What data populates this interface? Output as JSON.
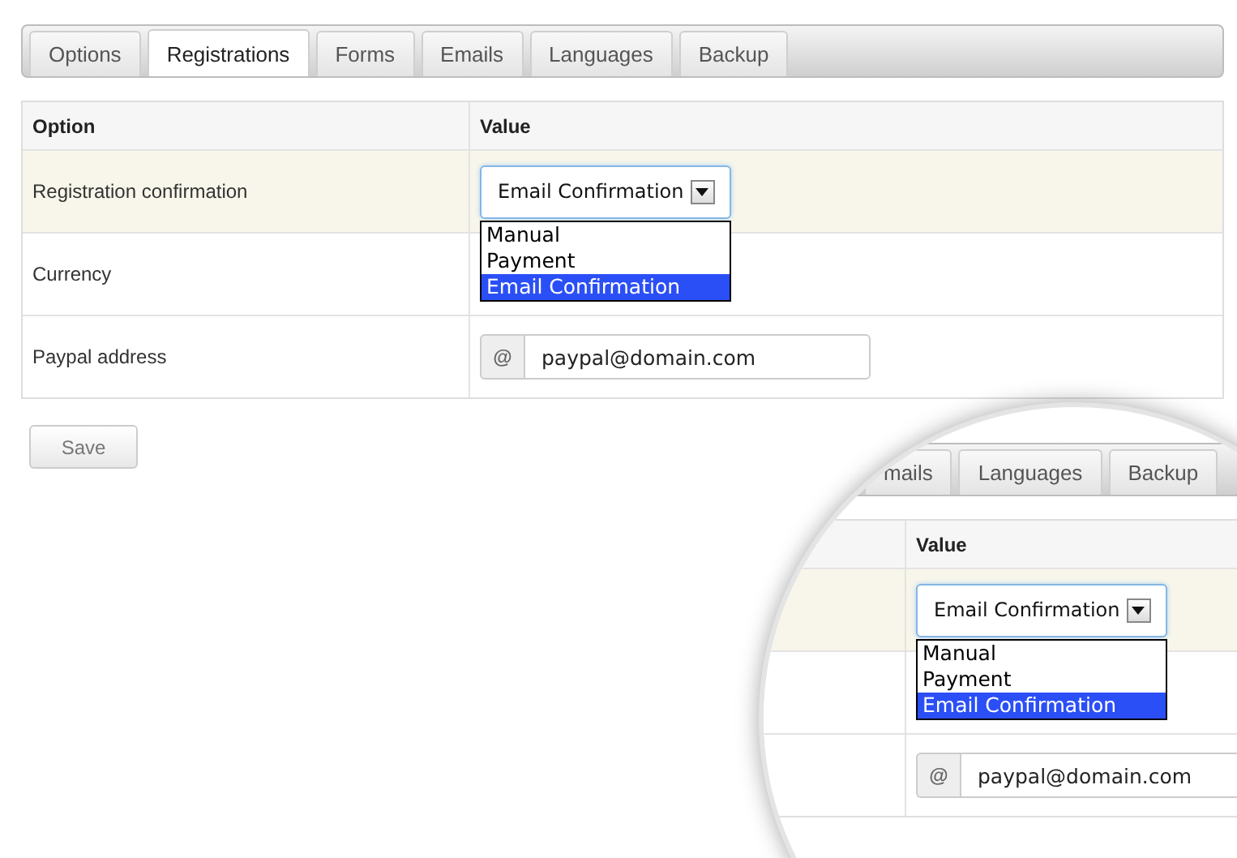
{
  "tabs": [
    {
      "label": "Options",
      "selected": false
    },
    {
      "label": "Registrations",
      "selected": true
    },
    {
      "label": "Forms",
      "selected": false
    },
    {
      "label": "Emails",
      "selected": false
    },
    {
      "label": "Languages",
      "selected": false
    },
    {
      "label": "Backup",
      "selected": false
    }
  ],
  "table": {
    "columns": [
      "Option",
      "Value"
    ],
    "rows": [
      {
        "option": "Registration confirmation",
        "kind": "select",
        "highlighted": true,
        "expanded": true,
        "value": "Email Confirmation",
        "options": [
          {
            "label": "Manual",
            "selected": false
          },
          {
            "label": "Payment",
            "selected": false
          },
          {
            "label": "Email Confirmation",
            "selected": true
          }
        ]
      },
      {
        "option": "Currency",
        "kind": "blank",
        "highlighted": false
      },
      {
        "option": "Paypal address",
        "kind": "addon-input",
        "highlighted": false,
        "addon": "@",
        "value": "paypal@domain.com"
      }
    ]
  },
  "save_button": "Save",
  "magnifier": {
    "tabs": [
      {
        "label": "mails",
        "selected": false
      },
      {
        "label": "Languages",
        "selected": false
      },
      {
        "label": "Backup",
        "selected": false
      }
    ],
    "table": {
      "columns": [
        "Value"
      ],
      "rows": [
        {
          "kind": "select",
          "highlighted": true,
          "expanded": true,
          "value": "Email Confirmation",
          "options": [
            {
              "label": "Manual",
              "selected": false
            },
            {
              "label": "Payment",
              "selected": false
            },
            {
              "label": "Email Confirmation",
              "selected": true
            }
          ]
        },
        {
          "kind": "blank",
          "highlighted": false
        },
        {
          "kind": "addon-input",
          "highlighted": false,
          "addon": "@",
          "value": "paypal@domain.com"
        }
      ]
    }
  }
}
